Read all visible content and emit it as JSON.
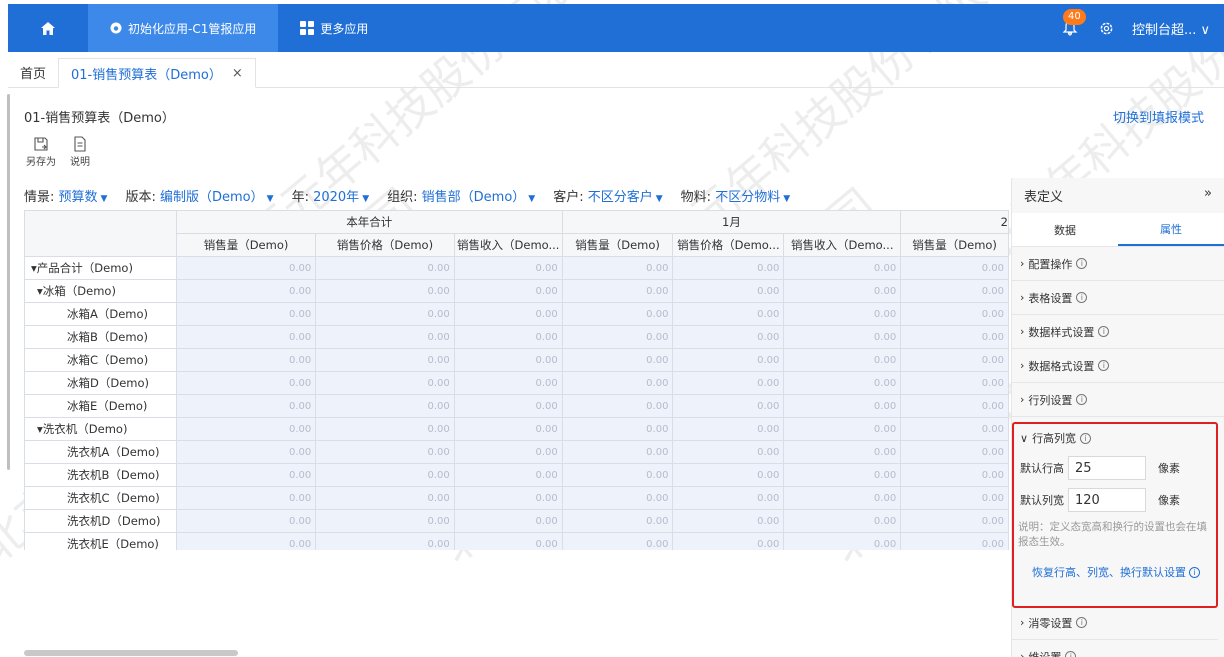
{
  "topbar": {
    "app_tab": "初始化应用-C1管报应用",
    "more_apps": "更多应用",
    "badge_count": "40",
    "user": "控制台超... ∨"
  },
  "tabs": [
    {
      "label": "首页"
    },
    {
      "label": "01-销售预算表（Demo）",
      "close": "×"
    }
  ],
  "page": {
    "title": "01-销售预算表（Demo）",
    "switch_mode": "切换到填报模式",
    "tools": [
      {
        "label": "另存为",
        "icon": "save-as-icon"
      },
      {
        "label": "说明",
        "icon": "document-icon"
      }
    ]
  },
  "filters": [
    {
      "label": "情景:",
      "value": "预算数"
    },
    {
      "label": "版本:",
      "value": "编制版（Demo）"
    },
    {
      "label": "年:",
      "value": "2020年"
    },
    {
      "label": "组织:",
      "value": "销售部（Demo）"
    },
    {
      "label": "客户:",
      "value": "不区分客户"
    },
    {
      "label": "物料:",
      "value": "不区分物料"
    }
  ],
  "grid": {
    "groups": [
      "本年合计",
      "1月",
      "2"
    ],
    "columns": [
      "销售量（Demo)",
      "销售价格（Demo)",
      "销售收入（Demo...",
      "销售量（Demo)",
      "销售价格（Demo...",
      "销售收入（Demo...",
      "销售量（Demo)"
    ],
    "rows": [
      {
        "name": "▾产品合计（Demo)",
        "level": 0
      },
      {
        "name": "▾冰箱（Demo)",
        "level": 1
      },
      {
        "name": "冰箱A（Demo)",
        "level": 2
      },
      {
        "name": "冰箱B（Demo)",
        "level": 2
      },
      {
        "name": "冰箱C（Demo)",
        "level": 2
      },
      {
        "name": "冰箱D（Demo)",
        "level": 2
      },
      {
        "name": "冰箱E（Demo)",
        "level": 2
      },
      {
        "name": "▾洗衣机（Demo)",
        "level": 1
      },
      {
        "name": "洗衣机A（Demo)",
        "level": 2
      },
      {
        "name": "洗衣机B（Demo)",
        "level": 2
      },
      {
        "name": "洗衣机C（Demo)",
        "level": 2
      },
      {
        "name": "洗衣机D（Demo)",
        "level": 2
      },
      {
        "name": "洗衣机E（Demo)",
        "level": 2
      }
    ],
    "cell_value": "0.00"
  },
  "panel": {
    "title": "表定义",
    "collapse": "»",
    "tabs": [
      "数据",
      "属性"
    ],
    "sections_top": [
      "配置操作",
      "表格设置",
      "数据样式设置",
      "数据格式设置",
      "行列设置"
    ],
    "row_col": {
      "title": "行高列宽",
      "row_height_label": "默认行高",
      "row_height_value": "25",
      "col_width_label": "默认列宽",
      "col_width_value": "120",
      "unit": "像素",
      "note": "说明：定义态宽高和换行的设置也会在填报态生效。",
      "restore": "恢复行高、列宽、换行默认设置"
    },
    "sections_bottom": [
      "消零设置",
      "维设置"
    ]
  },
  "watermark": "北京元年科技股份有限公司"
}
